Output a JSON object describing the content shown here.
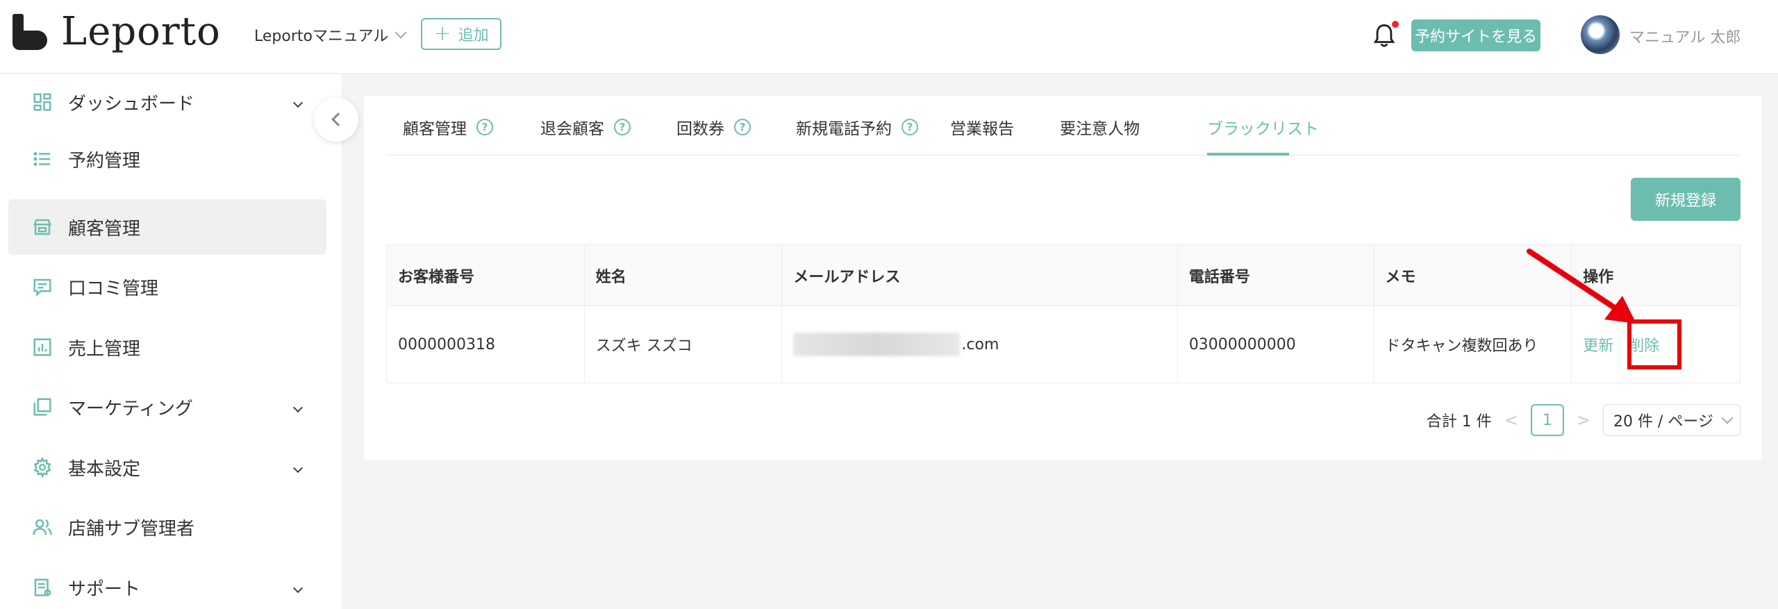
{
  "header": {
    "logo_text": "Leporto",
    "shop_select": "Leportoマニュアル",
    "add_label": "追加",
    "view_site_label": "予約サイトを見る",
    "user_name": "マニュアル 太郎"
  },
  "sidebar": {
    "items": [
      {
        "label": "ダッシュボード",
        "icon": "dashboard-icon",
        "has_chevron": true
      },
      {
        "label": "予約管理",
        "icon": "list-icon",
        "has_chevron": false
      },
      {
        "label": "顧客管理",
        "icon": "store-icon",
        "has_chevron": false,
        "active": true
      },
      {
        "label": "口コミ管理",
        "icon": "message-icon",
        "has_chevron": false
      },
      {
        "label": "売上管理",
        "icon": "chart-icon",
        "has_chevron": false
      },
      {
        "label": "マーケティング",
        "icon": "copy-icon",
        "has_chevron": true
      },
      {
        "label": "基本設定",
        "icon": "gear-icon",
        "has_chevron": true
      },
      {
        "label": "店舗サブ管理者",
        "icon": "users-icon",
        "has_chevron": false
      },
      {
        "label": "サポート",
        "icon": "document-icon",
        "has_chevron": true
      }
    ]
  },
  "tabs": [
    {
      "label": "顧客管理",
      "help": true
    },
    {
      "label": "退会顧客",
      "help": true
    },
    {
      "label": "回数券",
      "help": true
    },
    {
      "label": "新規電話予約",
      "help": true
    },
    {
      "label": "営業報告",
      "help": false
    },
    {
      "label": "要注意人物",
      "help": false
    },
    {
      "label": "ブラックリスト",
      "help": false,
      "active": true
    }
  ],
  "help_glyph": "?",
  "new_button_label": "新規登録",
  "table": {
    "columns": [
      "お客様番号",
      "姓名",
      "メールアドレス",
      "電話番号",
      "メモ",
      "操作"
    ],
    "rows": [
      {
        "customer_no": "0000000318",
        "name": "スズキ スズコ",
        "email_suffix": ".com",
        "phone": "03000000000",
        "memo": "ドタキャン複数回あり",
        "actions": [
          "更新",
          "削除"
        ]
      }
    ]
  },
  "pagination": {
    "total": "合計 1 件",
    "prev": "<",
    "current_page": "1",
    "next": ">",
    "page_size": "20 件 / ページ"
  },
  "colors": {
    "accent": "#6cbdb0",
    "highlight": "#e8000b"
  }
}
